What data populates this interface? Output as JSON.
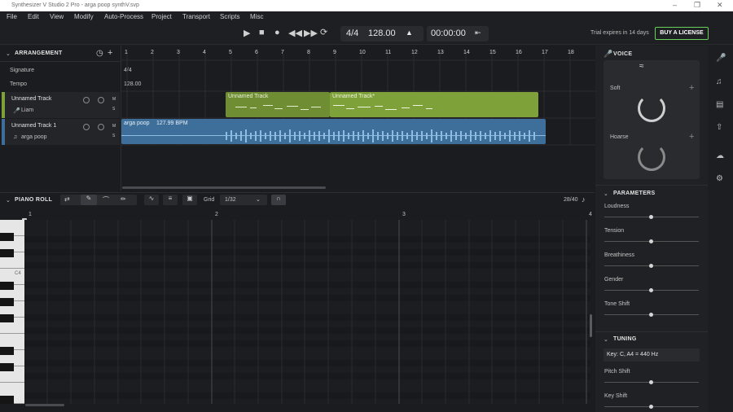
{
  "window": {
    "title": "Synthesizer V Studio 2 Pro - arga poop synthV.svp"
  },
  "menu": [
    "File",
    "Edit",
    "View",
    "Modify",
    "Auto-Process",
    "Project",
    "Transport",
    "Scripts",
    "Misc"
  ],
  "transport": {
    "time_signature": "4/4",
    "tempo": "128.00",
    "time": "00:00:00",
    "trial_text": "Trial expires in 14 days",
    "license_button": "BUY A LICENSE"
  },
  "arrangement": {
    "header": "ARRANGEMENT",
    "signature_label": "Signature",
    "signature_value": "4/4",
    "tempo_label": "Tempo",
    "tempo_value": "128.00",
    "ruler": [
      "1",
      "2",
      "3",
      "4",
      "5",
      "6",
      "7",
      "8",
      "9",
      "10",
      "11",
      "12",
      "13",
      "14",
      "15",
      "16",
      "17",
      "18"
    ],
    "tracks": [
      {
        "name": "Unnamed Track",
        "voice": "Liam",
        "m": "M",
        "s": "S"
      },
      {
        "name": "Unnamed Track 1",
        "voice": "arga poop",
        "m": "M",
        "s": "S"
      }
    ],
    "blocks": {
      "green1": "Unnamed Track",
      "green2": "Unnamed Track*",
      "audio": "arga poop",
      "audio_bpm": "127.99 BPM"
    }
  },
  "piano_roll": {
    "header": "PIANO ROLL",
    "grid_label": "Grid",
    "grid_value": "1/32",
    "count": "28/40",
    "ruler": [
      "1",
      "2",
      "3",
      "4"
    ],
    "c4_label": "C4"
  },
  "voice_panel": {
    "header": "VOICE",
    "soft": "Soft",
    "hoarse": "Hoarse",
    "parameters_header": "PARAMETERS",
    "parameters": [
      "Loudness",
      "Tension",
      "Breathiness",
      "Gender",
      "Tone Shift"
    ],
    "tuning_header": "TUNING",
    "key": "Key: C, A4 = 440 Hz",
    "tuning": [
      "Pitch Shift",
      "Key Shift"
    ]
  },
  "colors": {
    "green": "#7fa13a",
    "blue": "#3e6f9a",
    "accent": "#6bd05a"
  }
}
